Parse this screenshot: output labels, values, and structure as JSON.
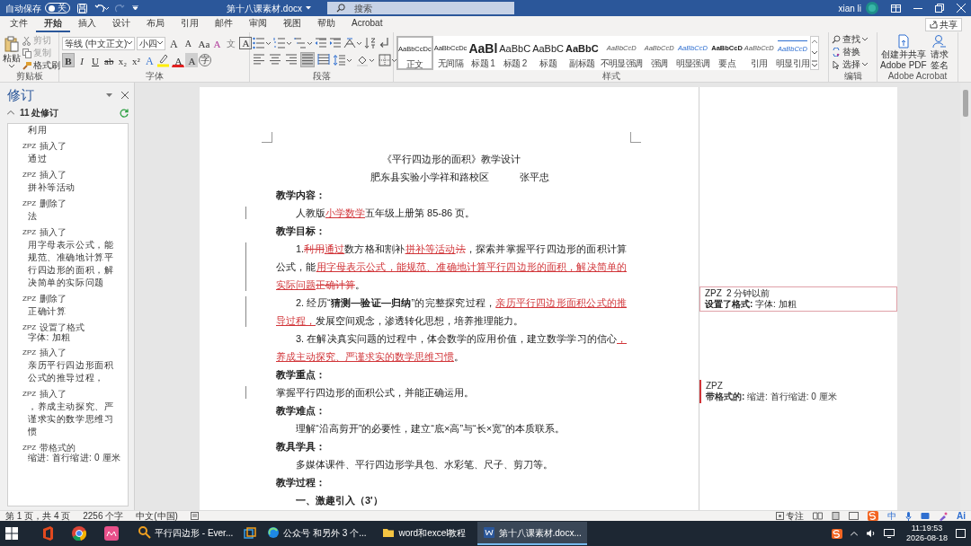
{
  "title_bar": {
    "autosave_label": "自动保存",
    "autosave": {
      "on": false,
      "state_label": "关"
    },
    "document_title": "第十八课素材.docx",
    "search": {
      "placeholder": "搜索"
    },
    "user": "xian li"
  },
  "ribbon_tabs": [
    {
      "label": "文件",
      "selected": false
    },
    {
      "label": "开始",
      "selected": true
    },
    {
      "label": "插入",
      "selected": false
    },
    {
      "label": "设计",
      "selected": false
    },
    {
      "label": "布局",
      "selected": false
    },
    {
      "label": "引用",
      "selected": false
    },
    {
      "label": "邮件",
      "selected": false
    },
    {
      "label": "审阅",
      "selected": false
    },
    {
      "label": "视图",
      "selected": false
    },
    {
      "label": "帮助",
      "selected": false
    },
    {
      "label": "Acrobat",
      "selected": false
    }
  ],
  "share_button": "共享",
  "clipboard": {
    "paste": "粘贴",
    "items": [
      {
        "label": "剪切",
        "disabled": true
      },
      {
        "label": "复制",
        "disabled": true
      },
      {
        "label": "格式刷",
        "disabled": false
      }
    ],
    "group_label": "剪贴板"
  },
  "font": {
    "name": "等线 (中文正文)",
    "size": "小四",
    "row1": [
      {
        "kind": "grow",
        "glyph": "A"
      },
      {
        "kind": "shrink",
        "glyph": "A"
      },
      {
        "kind": "case",
        "glyph": "Aa"
      },
      {
        "kind": "clear",
        "glyph": "A"
      },
      {
        "kind": "phonetic",
        "glyph": "文"
      },
      {
        "kind": "border",
        "glyph": "A"
      }
    ],
    "row2": [
      {
        "kind": "bold",
        "glyph": "B",
        "on": true
      },
      {
        "kind": "italic",
        "glyph": "I",
        "on": false
      },
      {
        "kind": "underline",
        "glyph": "U",
        "on": false
      },
      {
        "kind": "strike",
        "glyph": "ab",
        "on": false
      },
      {
        "kind": "sub",
        "glyph": "x₂",
        "on": false
      },
      {
        "kind": "sup",
        "glyph": "x²",
        "on": false
      },
      {
        "kind": "effect",
        "glyph": "A",
        "on": false
      },
      {
        "kind": "highlight",
        "color": "#ffee00",
        "on": false
      },
      {
        "kind": "color",
        "glyph": "A",
        "color": "#e02020",
        "on": false
      },
      {
        "kind": "shade",
        "glyph": "A",
        "on": false
      },
      {
        "kind": "enclose",
        "glyph": "字",
        "on": false
      }
    ],
    "group_label": "字体"
  },
  "paragraph": {
    "align": [
      {
        "on": false
      },
      {
        "on": false
      },
      {
        "on": false
      },
      {
        "on": true
      },
      {
        "on": false
      }
    ],
    "group_label": "段落"
  },
  "styles": {
    "items": [
      {
        "preview": "AaBbCcDc",
        "label": "正文",
        "kind": "normal",
        "selected": true
      },
      {
        "preview": "AaBbCcDc",
        "label": "无间隔",
        "kind": "normal",
        "selected": false
      },
      {
        "preview": "AaBl",
        "label": "标题 1",
        "kind": "heading1",
        "selected": false
      },
      {
        "preview": "AaBbC",
        "label": "标题 2",
        "kind": "heading2",
        "selected": false
      },
      {
        "preview": "AaBbC",
        "label": "标题",
        "kind": "heading2",
        "selected": false
      },
      {
        "preview": "AaBbC",
        "label": "副标题",
        "kind": "subtitle",
        "selected": false
      },
      {
        "preview": "AaBbCcD",
        "label": "不明显强调",
        "kind": "emphasis",
        "selected": false
      },
      {
        "preview": "AaBbCcD",
        "label": "强调",
        "kind": "emphasis",
        "selected": false
      },
      {
        "preview": "AaBbCcD",
        "label": "明显强调",
        "kind": "emphasis-blue",
        "selected": false
      },
      {
        "preview": "AaBbCcD",
        "label": "要点",
        "kind": "strong",
        "selected": false
      },
      {
        "preview": "AaBbCcD",
        "label": "引用",
        "kind": "emphasis",
        "selected": false
      },
      {
        "preview": "AaBbCcD",
        "label": "明显引用",
        "kind": "quote-blue",
        "selected": false
      }
    ],
    "group_label": "样式"
  },
  "editing": {
    "items": [
      {
        "label": "查找",
        "dropdown": true
      },
      {
        "label": "替换",
        "dropdown": false
      },
      {
        "label": "选择",
        "dropdown": true
      }
    ],
    "group_label": "编辑"
  },
  "adobe": {
    "buttons": [
      {
        "lines": [
          "创建并共享",
          "Adobe PDF"
        ]
      },
      {
        "lines": [
          "请求",
          "签名"
        ]
      }
    ],
    "group_label": "Adobe Acrobat"
  },
  "revisions_pane": {
    "title": "修订",
    "count": "11 处修订",
    "items": [
      {
        "kind": "change",
        "text": "利用"
      },
      {
        "kind": "change",
        "author": "ZPZ",
        "action": "插入了",
        "text": "通过"
      },
      {
        "kind": "change",
        "author": "ZPZ",
        "action": "插入了",
        "text": "拼补等活动"
      },
      {
        "kind": "change",
        "author": "ZPZ",
        "action": "删除了",
        "text": "法"
      },
      {
        "kind": "change",
        "author": "ZPZ",
        "action": "插入了",
        "text": "用字母表示公式，能规范、准确地计算平行四边形的面积，解决简单的实际问题"
      },
      {
        "kind": "change",
        "author": "ZPZ",
        "action": "删除了",
        "text": "正确计算"
      },
      {
        "kind": "format",
        "author": "ZPZ",
        "action": "设置了格式",
        "text": "字体: 加粗"
      },
      {
        "kind": "change",
        "author": "ZPZ",
        "action": "插入了",
        "text": "亲历平行四边形面积公式的推导过程，"
      },
      {
        "kind": "change",
        "author": "ZPZ",
        "action": "插入了",
        "text": "，养成主动探究、严谨求实的数学思维习惯"
      },
      {
        "kind": "format",
        "author": "ZPZ",
        "action": "带格式的",
        "text": "缩进: 首行缩进:  0 厘米"
      }
    ]
  },
  "document": {
    "paragraphs": [
      {
        "kind": "title",
        "changed": false,
        "segments": [
          {
            "kind": "normal",
            "text": "《平行四边形的面积》教学设计"
          }
        ]
      },
      {
        "kind": "byline",
        "changed": false,
        "texts": [
          "肥东县实验小学祥和路校区",
          "张平忠"
        ]
      },
      {
        "kind": "heading",
        "changed": false,
        "segments": [
          {
            "kind": "normal",
            "text": "教学内容："
          }
        ]
      },
      {
        "kind": "indent",
        "changed": true,
        "segments": [
          {
            "kind": "normal",
            "text": "人教版"
          },
          {
            "kind": "insert",
            "text": "小学数学"
          },
          {
            "kind": "normal",
            "text": "五年级上册第 85-86 页。"
          }
        ]
      },
      {
        "kind": "heading",
        "changed": false,
        "segments": [
          {
            "kind": "normal",
            "text": "教学目标："
          }
        ]
      },
      {
        "kind": "indent",
        "changed": true,
        "segments": [
          {
            "kind": "normal",
            "text": "1."
          },
          {
            "kind": "delete",
            "text": "利用"
          },
          {
            "kind": "insert",
            "text": "通过"
          },
          {
            "kind": "normal",
            "text": "数方格和割补"
          },
          {
            "kind": "insert",
            "text": "拼补等活动"
          },
          {
            "kind": "delete",
            "text": "法"
          },
          {
            "kind": "normal",
            "text": "，探索并掌握平行四边形的面积计算公式，能"
          },
          {
            "kind": "insert",
            "text": "用字母表示公式，能规范、准确地计算平行四边形的面积，解决简单的实际问题"
          },
          {
            "kind": "delete",
            "text": "正确计算"
          },
          {
            "kind": "normal",
            "text": "。"
          }
        ]
      },
      {
        "kind": "indent",
        "changed": true,
        "segments": [
          {
            "kind": "normal",
            "text": "2. 经历“"
          },
          {
            "kind": "bold",
            "text": "猜测—验证—归纳"
          },
          {
            "kind": "normal",
            "text": "”的完整探究过程，"
          },
          {
            "kind": "insert",
            "text": "亲历平行四边形面积公式的推导过程，"
          },
          {
            "kind": "normal",
            "text": "发展空间观念，渗透转化思想，培养推理能力。"
          }
        ]
      },
      {
        "kind": "indent",
        "changed": false,
        "segments": [
          {
            "kind": "normal",
            "text": "3. 在解决真实问题的过程中，体会数学的应用价值，建立数学学习的信心"
          },
          {
            "kind": "insert",
            "text": "，养成主动探究、严谨求实的数学思维习惯"
          },
          {
            "kind": "normal",
            "text": "。"
          }
        ]
      },
      {
        "kind": "heading",
        "changed": false,
        "segments": [
          {
            "kind": "normal",
            "text": "教学重点："
          }
        ]
      },
      {
        "kind": "plain",
        "changed": true,
        "segments": [
          {
            "kind": "normal",
            "text": "掌握平行四边形的面积公式，并能正确运用。"
          }
        ]
      },
      {
        "kind": "heading",
        "changed": false,
        "segments": [
          {
            "kind": "normal",
            "text": "教学难点："
          }
        ]
      },
      {
        "kind": "indent",
        "changed": false,
        "segments": [
          {
            "kind": "normal",
            "text": "理解“沿高剪开”的必要性，建立“底×高”与“长×宽”的本质联系。"
          }
        ]
      },
      {
        "kind": "heading",
        "changed": false,
        "segments": [
          {
            "kind": "normal",
            "text": "教具学具："
          }
        ]
      },
      {
        "kind": "indent",
        "changed": false,
        "segments": [
          {
            "kind": "normal",
            "text": "多媒体课件、平行四边形学具包、水彩笔、尺子、剪刀等。"
          }
        ]
      },
      {
        "kind": "heading",
        "changed": false,
        "segments": [
          {
            "kind": "normal",
            "text": "教学过程："
          }
        ]
      },
      {
        "kind": "subheading",
        "changed": false,
        "segments": [
          {
            "kind": "normal",
            "text": "一、激趣引入（3'）"
          }
        ]
      }
    ],
    "comments": [
      {
        "author": "ZPZ",
        "time": "2 分钟以前",
        "text": "**设置了格式:** 字体: 加粗"
      },
      {
        "author": "ZPZ",
        "text": "**带格式的:** 缩进: 首行缩进:  0 厘米"
      }
    ]
  },
  "status_bar": {
    "page": "第 1 页，共 4 页",
    "words": "2256 个字",
    "language": "中文(中国)",
    "focus": "专注",
    "ime_mode": "中",
    "ai": "Ai"
  },
  "taskbar": {
    "apps": [
      {
        "label": "平行四边形 - Ever...",
        "active": false
      },
      {
        "label": "公众号 和另外 3 个...",
        "active": false
      },
      {
        "label": "word和excel教程",
        "active": false
      },
      {
        "label": "第十八课素材.docx...",
        "active": true
      }
    ],
    "time": "11:19:53",
    "date": "2026-08-18"
  }
}
